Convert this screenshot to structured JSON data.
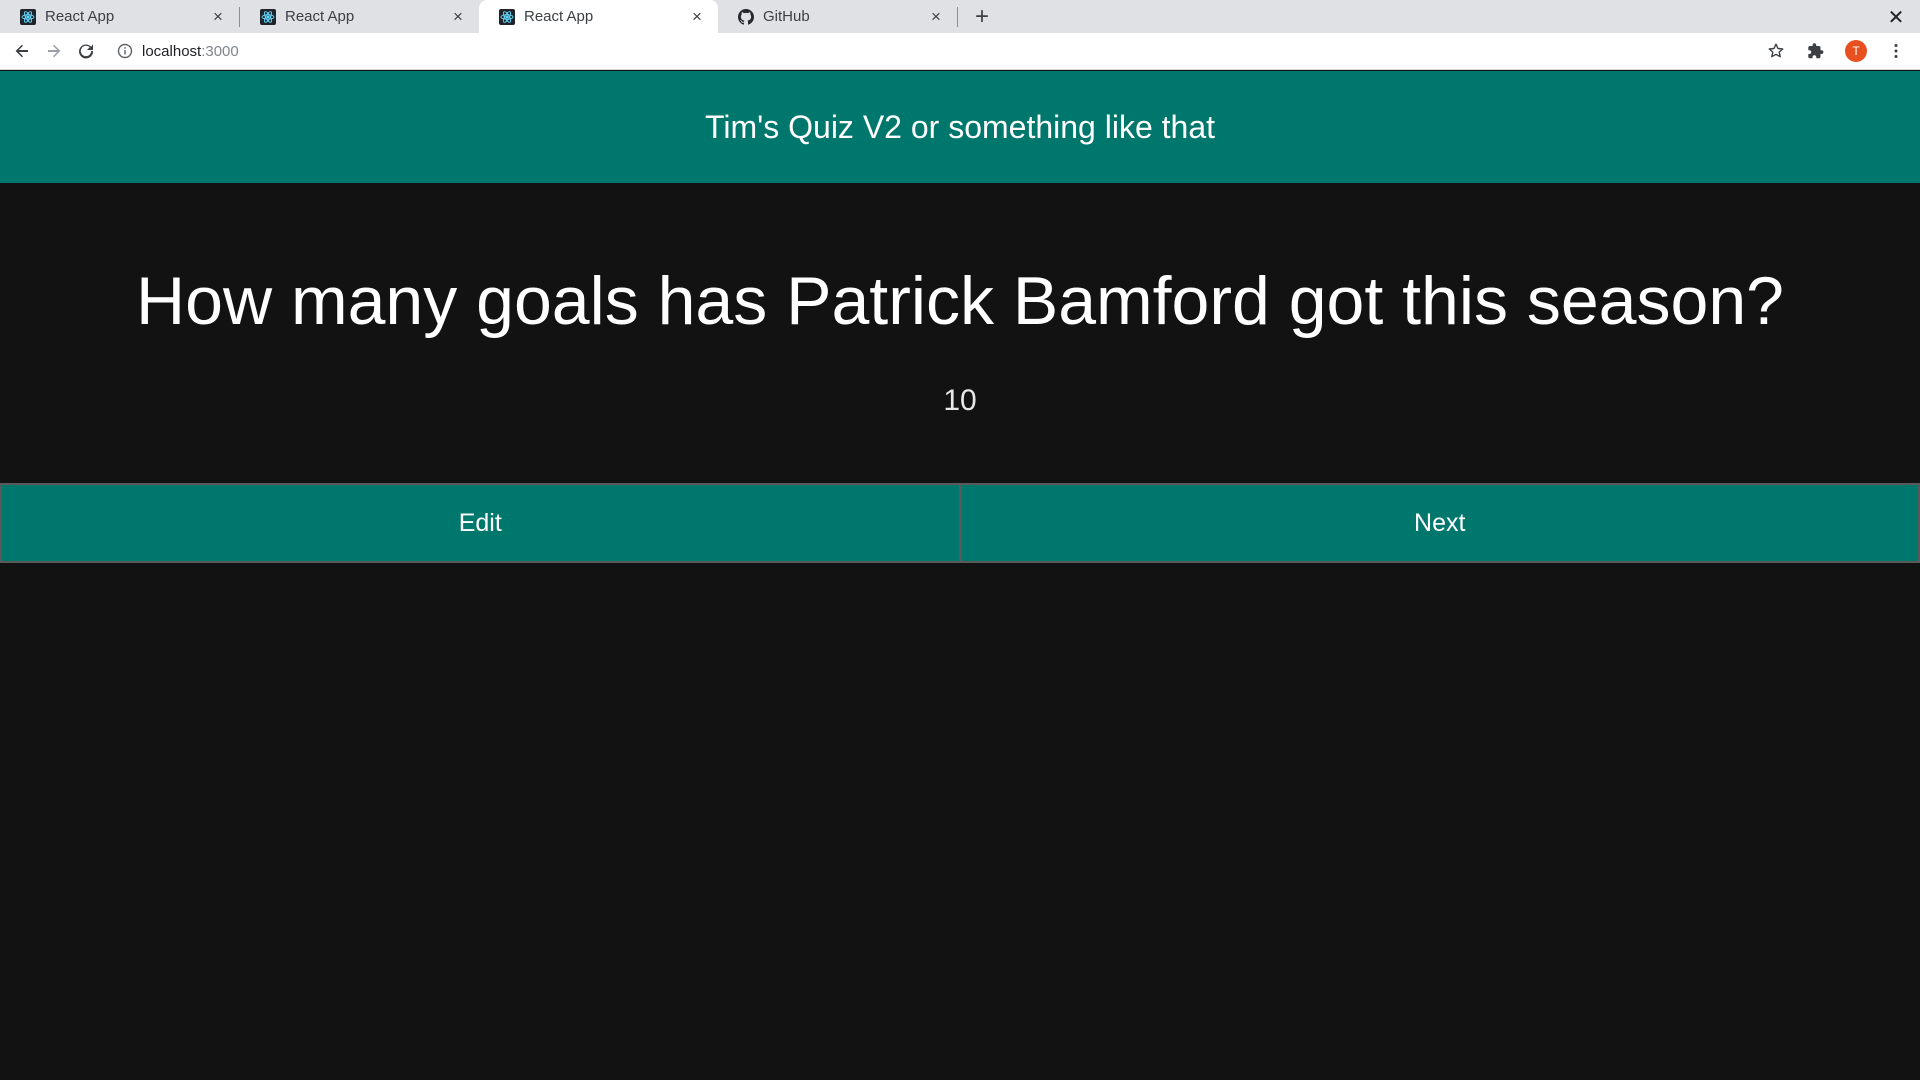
{
  "browser": {
    "tabs": [
      {
        "title": "React App",
        "favicon": "react-icon",
        "active": false
      },
      {
        "title": "React App",
        "favicon": "react-icon",
        "active": false
      },
      {
        "title": "React App",
        "favicon": "react-icon",
        "active": true
      },
      {
        "title": "GitHub",
        "favicon": "github-icon",
        "active": false
      }
    ],
    "new_tab_label": "+",
    "close_label": "×",
    "window_close_label": "✕",
    "address": {
      "host": "localhost",
      "port": ":3000"
    },
    "profile_initial": "T"
  },
  "app": {
    "title": "Tim's Quiz V2 or something like that",
    "question": "How many goals has Patrick Bamford got this season?",
    "answer": "10",
    "buttons": {
      "edit": "Edit",
      "next": "Next"
    }
  },
  "colors": {
    "header_bg": "#00776d",
    "page_bg": "#121212",
    "avatar": "#e8501f"
  }
}
